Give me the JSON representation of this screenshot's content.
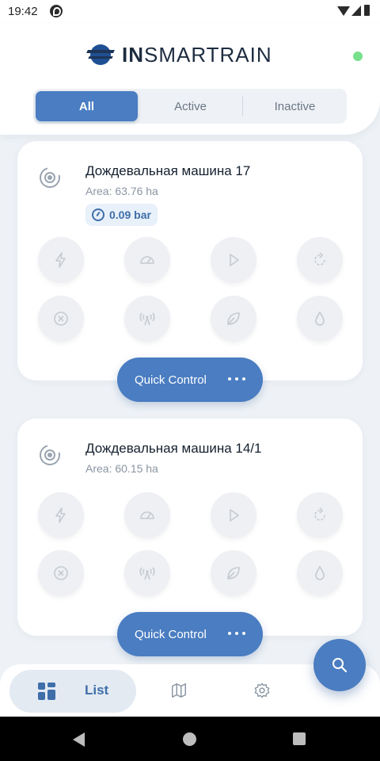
{
  "status_bar": {
    "time": "19:42"
  },
  "header": {
    "logo_bold": "IN",
    "logo_rest": "SMARTRAIN",
    "connection_status_color": "#77e08a"
  },
  "filter_tabs": [
    {
      "label": "All",
      "selected": true
    },
    {
      "label": "Active",
      "selected": false
    },
    {
      "label": "Inactive",
      "selected": false
    }
  ],
  "machines": [
    {
      "name": "Дождевальная машина 17",
      "area": "Area: 63.76 ha",
      "pressure": "0.09 bar",
      "quick_control_label": "Quick Control"
    },
    {
      "name": "Дождевальная машина 14/1",
      "area": "Area: 60.15 ha",
      "quick_control_label": "Quick Control"
    }
  ],
  "control_icons": [
    "lightning-icon",
    "speedometer-icon",
    "play-icon",
    "rotate-icon",
    "close-circle-icon",
    "antenna-icon",
    "leaf-icon",
    "water-drop-icon"
  ],
  "bottom_nav": {
    "list_label": "List",
    "items": [
      "list-icon",
      "map-icon",
      "settings-icon"
    ]
  },
  "colors": {
    "accent": "#4a7dc1",
    "accent_dark": "#3f6ea9",
    "background": "#eef2f6"
  }
}
